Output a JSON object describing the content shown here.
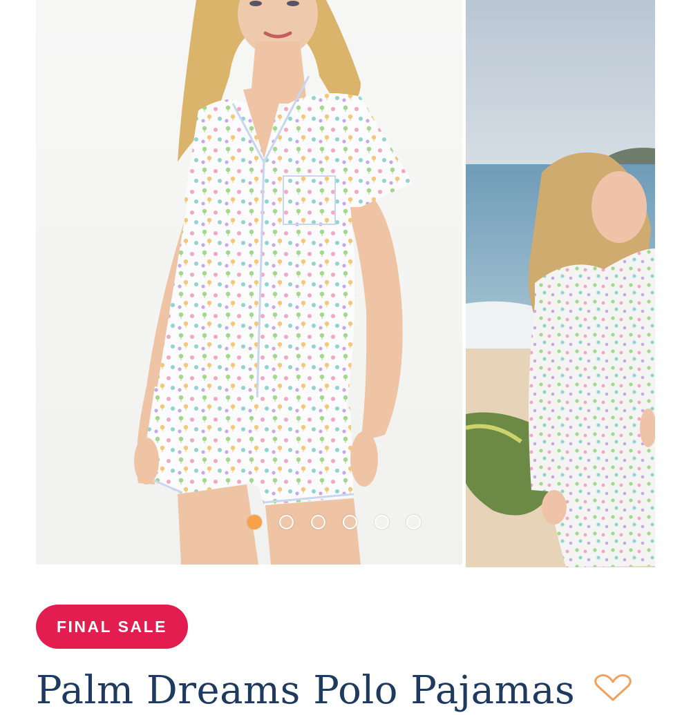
{
  "gallery": {
    "slides": [
      {
        "label": "model wearing palm print short pajama set, studio"
      },
      {
        "label": "model wearing palm print long pajama set, beach"
      }
    ],
    "dots": [
      "active",
      "",
      "",
      "",
      "",
      ""
    ]
  },
  "product": {
    "badge": "FINAL SALE",
    "title": "Palm Dreams Polo Pajamas"
  },
  "icons": {
    "favorite": "heart-icon"
  },
  "colors": {
    "badge_bg": "#e31d4f",
    "title": "#1e3a5f",
    "active_dot": "#f7a24a",
    "heart": "#f2a05a"
  }
}
